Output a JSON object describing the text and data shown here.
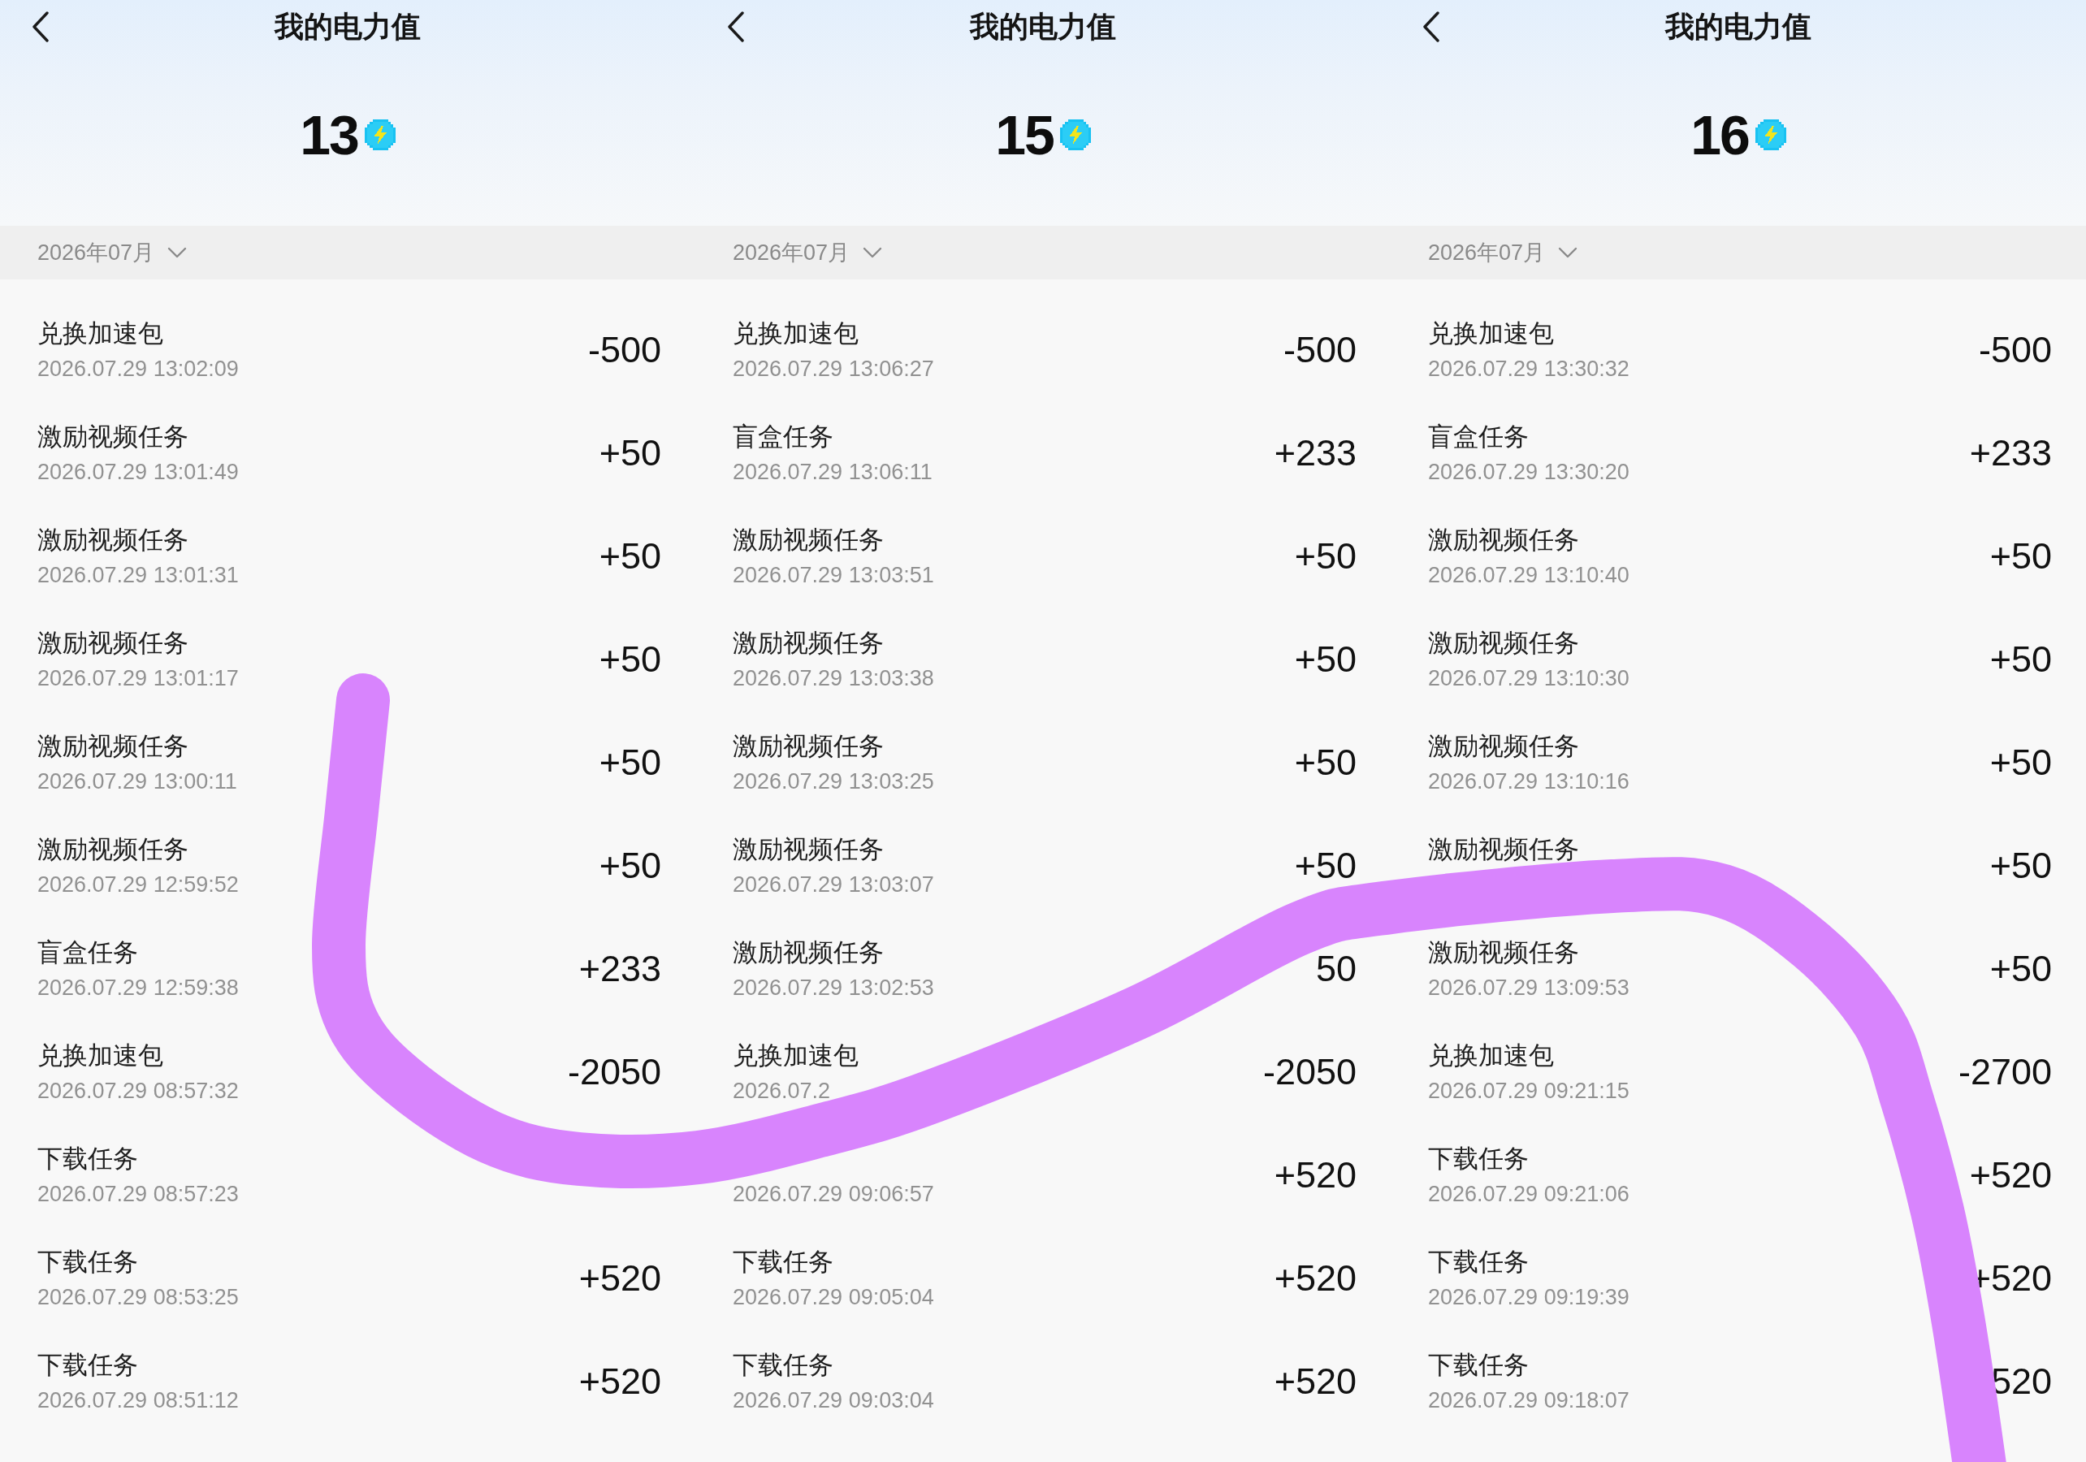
{
  "panels": [
    {
      "header": {
        "title": "我的电力值",
        "balance": "13"
      },
      "month_filter": "2026年07月",
      "records": [
        {
          "title": "兑换加速包",
          "time": "2026.07.29 13:02:09",
          "amount": "-500"
        },
        {
          "title": "激励视频任务",
          "time": "2026.07.29 13:01:49",
          "amount": "+50"
        },
        {
          "title": "激励视频任务",
          "time": "2026.07.29 13:01:31",
          "amount": "+50"
        },
        {
          "title": "激励视频任务",
          "time": "2026.07.29 13:01:17",
          "amount": "+50"
        },
        {
          "title": "激励视频任务",
          "time": "2026.07.29 13:00:11",
          "amount": "+50"
        },
        {
          "title": "激励视频任务",
          "time": "2026.07.29 12:59:52",
          "amount": "+50"
        },
        {
          "title": "盲盒任务",
          "time": "2026.07.29 12:59:38",
          "amount": "+233"
        },
        {
          "title": "兑换加速包",
          "time": "2026.07.29 08:57:32",
          "amount": "-2050"
        },
        {
          "title": "下载任务",
          "time": "2026.07.29 08:57:23"
        },
        {
          "title": "下载任务",
          "time": "2026.07.29 08:53:25",
          "amount": "+520"
        },
        {
          "title": "下载任务",
          "time": "2026.07.29 08:51:12",
          "amount": "+520"
        }
      ]
    },
    {
      "header": {
        "title": "我的电力值",
        "balance": "15"
      },
      "month_filter": "2026年07月",
      "records": [
        {
          "title": "兑换加速包",
          "time": "2026.07.29 13:06:27",
          "amount": "-500"
        },
        {
          "title": "盲盒任务",
          "time": "2026.07.29 13:06:11",
          "amount": "+233"
        },
        {
          "title": "激励视频任务",
          "time": "2026.07.29 13:03:51",
          "amount": "+50"
        },
        {
          "title": "激励视频任务",
          "time": "2026.07.29 13:03:38",
          "amount": "+50"
        },
        {
          "title": "激励视频任务",
          "time": "2026.07.29 13:03:25",
          "amount": "+50"
        },
        {
          "title": "激励视频任务",
          "time": "2026.07.29 13:03:07",
          "amount": "+50"
        },
        {
          "title": "激励视频任务",
          "time": "2026.07.29 13:02:53",
          "amount": "50"
        },
        {
          "title": "兑换加速包",
          "time": "2026.07.2",
          "amount": "-2050"
        },
        {
          "time": "2026.07.29 09:06:57",
          "amount": "+520"
        },
        {
          "title": "下载任务",
          "time": "2026.07.29 09:05:04",
          "amount": "+520"
        },
        {
          "title": "下载任务",
          "time": "2026.07.29 09:03:04",
          "amount": "+520"
        }
      ]
    },
    {
      "header": {
        "title": "我的电力值",
        "balance": "16"
      },
      "month_filter": "2026年07月",
      "records": [
        {
          "title": "兑换加速包",
          "time": "2026.07.29 13:30:32",
          "amount": "-500"
        },
        {
          "title": "盲盒任务",
          "time": "2026.07.29 13:30:20",
          "amount": "+233"
        },
        {
          "title": "激励视频任务",
          "time": "2026.07.29 13:10:40",
          "amount": "+50"
        },
        {
          "title": "激励视频任务",
          "time": "2026.07.29 13:10:30",
          "amount": "+50"
        },
        {
          "title": "激励视频任务",
          "time": "2026.07.29 13:10:16",
          "amount": "+50"
        },
        {
          "title": "激励视频任务",
          "amount": "+50"
        },
        {
          "title": "激励视频任务",
          "time": "2026.07.29 13:09:53",
          "amount": "+50"
        },
        {
          "title": "兑换加速包",
          "time": "2026.07.29 09:21:15",
          "amount": "-2700"
        },
        {
          "title": "下载任务",
          "time": "2026.07.29 09:21:06",
          "amount": "+520"
        },
        {
          "title": "下载任务",
          "time": "2026.07.29 09:19:39",
          "amount": "+520"
        },
        {
          "title": "下载任务",
          "time": "2026.07.29 09:18:07",
          "amount": "520"
        }
      ]
    }
  ]
}
